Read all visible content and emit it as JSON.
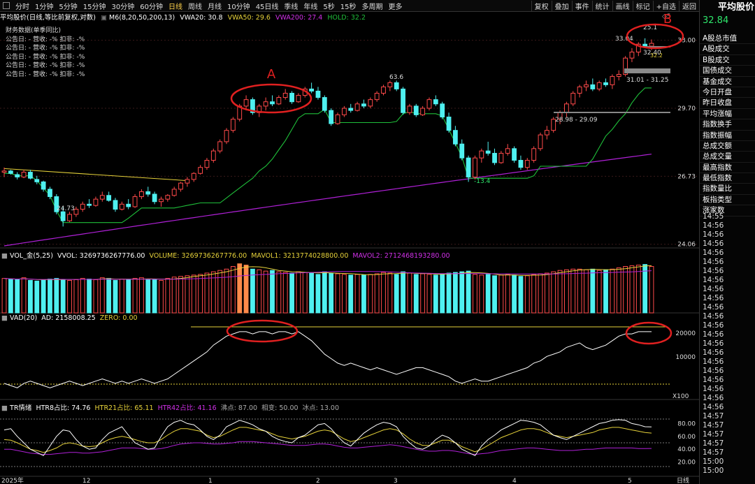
{
  "toolbar": {
    "periods": [
      "分时",
      "1分钟",
      "5分钟",
      "15分钟",
      "30分钟",
      "60分钟",
      "日线",
      "周线",
      "月线",
      "10分钟",
      "45日线",
      "季线",
      "年线",
      "5秒",
      "15秒",
      "多周期",
      "更多"
    ],
    "active_period": "日线",
    "right_buttons": [
      "复权",
      "叠加",
      "事件",
      "统计",
      "画线",
      "标记",
      "+自选",
      "返回"
    ]
  },
  "header": {
    "title": "平均股价(日线,等比前复权,对数)",
    "ma_label": "M6(8,20,50,200,13)",
    "vwa20": "VWA20: 30.8",
    "vwa50": "VWA50: 29.6",
    "vwa200": "VWA200: 27.4",
    "hold": "HOLD: 32.2"
  },
  "financials": {
    "title": "财务数据(单季同比)",
    "rows": [
      "公告日: -   营收: -%   扣非: -%",
      "公告日: -   营收: -%   扣非: -%",
      "公告日: -   营收: -%   扣非: -%",
      "公告日: -   营收: -%   扣非: -%",
      "公告日: -   营收: -%   扣非: -%"
    ]
  },
  "right_panel": {
    "title": "平均股价",
    "price": "32.84",
    "items": [
      "A股总市值",
      "A股成交",
      "B股成交",
      "国债成交",
      "基金成交",
      "今日开盘",
      "昨日收盘",
      "平均涨幅",
      "指数换手",
      "指数振幅",
      "总成交额",
      "总成交量",
      "最高指数",
      "最低指数",
      "指数量比",
      "板指类型",
      "涨家数"
    ],
    "times": [
      "14:55",
      "14:56",
      "14:56",
      "14:56",
      "14:56",
      "14:56",
      "14:56",
      "14:56",
      "14:56",
      "14:56",
      "14:56",
      "14:56",
      "14:56",
      "14:56",
      "14:56",
      "14:56",
      "14:56",
      "14:56",
      "14:56",
      "14:56",
      "14:56",
      "14:56",
      "14:57",
      "14:57",
      "14:57",
      "14:57",
      "14:57",
      "15:00",
      "15:00"
    ]
  },
  "annotations": {
    "a": "A",
    "b": "B"
  },
  "price_panel": {
    "yticks": [
      "33.00",
      "29.70",
      "26.73",
      "24.06"
    ],
    "labels": {
      "high1": "63.6",
      "low1": "24.73",
      "low2": "-13.4",
      "top_high": "25.1",
      "top_left": "33.04",
      "top_val": "32.40",
      "top_small": "32.2",
      "range1": "31.01 - 31.25",
      "range2": "28.98 - 29.09",
      "mark": "◇5"
    }
  },
  "vol_panel": {
    "name": "VOL_金(5,25)",
    "vvol": "VVOL: 3269736267776.00",
    "volume": "VOLUME: 3269736267776.00",
    "mavol1": "MAVOL1: 3213774028800.00",
    "mavol2": "MAVOL2: 2712468193280.00"
  },
  "vad_panel": {
    "name": "VAD(20)",
    "ad": "AD: 2158008.25",
    "zero": "ZERO: 0.00",
    "yticks": [
      "20000",
      "10000"
    ],
    "unit": "X100"
  },
  "tr_panel": {
    "name": "TR情绪",
    "htr8": "HTR8占比: 74.76",
    "htr21": "HTR21占比: 65.11",
    "htr42": "HTR42占比: 41.16",
    "boil": "沸点: 87.00",
    "neutral": "相变: 50.00",
    "ice": "冰点: 13.00",
    "yticks": [
      "80.00",
      "60.00",
      "40.00",
      "20.00"
    ]
  },
  "xaxis": {
    "labels": [
      "2025年",
      "12",
      "1",
      "2",
      "3",
      "4",
      "5"
    ],
    "period": "日线"
  },
  "colors": {
    "up": "#ff4a4a",
    "down": "#4ff0f0",
    "ma_green": "#1fbf3a",
    "ma_purple": "#b020d8",
    "yellow": "#e6d23a",
    "annot_red": "#e02020"
  },
  "chart_data": {
    "type": "candlestick",
    "ohlc": [
      [
        26.9,
        27.1,
        26.7,
        26.95
      ],
      [
        26.95,
        27.0,
        26.8,
        26.85
      ],
      [
        26.8,
        26.9,
        26.6,
        26.7
      ],
      [
        26.7,
        27.0,
        26.65,
        26.9
      ],
      [
        26.9,
        27.0,
        26.6,
        26.65
      ],
      [
        26.6,
        26.75,
        26.4,
        26.5
      ],
      [
        26.5,
        26.55,
        26.1,
        26.2
      ],
      [
        26.2,
        26.3,
        25.8,
        25.9
      ],
      [
        25.9,
        26.0,
        25.2,
        25.3
      ],
      [
        25.3,
        25.5,
        24.73,
        24.95
      ],
      [
        24.95,
        25.3,
        24.9,
        25.2
      ],
      [
        25.2,
        25.5,
        25.1,
        25.4
      ],
      [
        25.4,
        25.7,
        25.3,
        25.6
      ],
      [
        25.6,
        25.8,
        25.45,
        25.55
      ],
      [
        25.55,
        25.9,
        25.5,
        25.8
      ],
      [
        25.8,
        26.1,
        25.7,
        25.95
      ],
      [
        25.95,
        26.1,
        25.7,
        25.75
      ],
      [
        25.75,
        25.85,
        25.3,
        25.4
      ],
      [
        25.4,
        25.7,
        25.35,
        25.6
      ],
      [
        25.6,
        25.8,
        25.4,
        25.5
      ],
      [
        25.5,
        26.0,
        25.45,
        25.9
      ],
      [
        25.9,
        26.2,
        25.8,
        26.1
      ],
      [
        26.1,
        26.3,
        25.9,
        26.0
      ],
      [
        26.0,
        26.1,
        25.6,
        25.7
      ],
      [
        25.7,
        25.9,
        25.5,
        25.8
      ],
      [
        25.8,
        26.0,
        25.7,
        25.95
      ],
      [
        25.95,
        26.3,
        25.9,
        26.2
      ],
      [
        26.2,
        26.5,
        26.1,
        26.45
      ],
      [
        26.45,
        26.7,
        26.3,
        26.6
      ],
      [
        26.6,
        26.9,
        26.5,
        26.85
      ],
      [
        26.85,
        27.2,
        26.8,
        27.1
      ],
      [
        27.1,
        27.5,
        27.0,
        27.4
      ],
      [
        27.4,
        27.9,
        27.3,
        27.8
      ],
      [
        27.8,
        28.3,
        27.7,
        28.2
      ],
      [
        28.2,
        28.8,
        28.1,
        28.7
      ],
      [
        28.7,
        29.3,
        28.6,
        29.2
      ],
      [
        29.2,
        29.9,
        29.1,
        29.8
      ],
      [
        29.8,
        30.3,
        29.6,
        30.1
      ],
      [
        30.1,
        30.2,
        29.4,
        29.5
      ],
      [
        29.5,
        29.9,
        29.3,
        29.8
      ],
      [
        29.8,
        30.2,
        29.6,
        30.0
      ],
      [
        30.0,
        30.3,
        29.8,
        29.9
      ],
      [
        29.9,
        30.3,
        29.85,
        30.2
      ],
      [
        30.2,
        30.6,
        30.1,
        30.4
      ],
      [
        30.4,
        30.5,
        29.9,
        30.0
      ],
      [
        30.0,
        30.4,
        29.95,
        30.3
      ],
      [
        30.3,
        30.7,
        30.2,
        30.6
      ],
      [
        30.6,
        30.9,
        30.4,
        30.5
      ],
      [
        30.5,
        30.7,
        30.1,
        30.2
      ],
      [
        30.2,
        30.3,
        29.5,
        29.6
      ],
      [
        29.6,
        29.7,
        28.9,
        29.0
      ],
      [
        29.0,
        29.5,
        28.95,
        29.4
      ],
      [
        29.4,
        29.8,
        29.3,
        29.7
      ],
      [
        29.7,
        29.9,
        29.5,
        29.6
      ],
      [
        29.6,
        30.0,
        29.55,
        29.9
      ],
      [
        29.9,
        30.1,
        29.7,
        29.8
      ],
      [
        29.8,
        30.2,
        29.7,
        30.1
      ],
      [
        30.1,
        30.5,
        30.0,
        30.4
      ],
      [
        30.4,
        30.8,
        30.3,
        30.7
      ],
      [
        30.7,
        31.0,
        30.5,
        30.9
      ],
      [
        30.9,
        31.0,
        30.5,
        30.6
      ],
      [
        30.6,
        30.7,
        29.4,
        29.5
      ],
      [
        29.5,
        29.9,
        29.4,
        29.8
      ],
      [
        29.8,
        29.9,
        29.3,
        29.4
      ],
      [
        29.4,
        29.8,
        29.35,
        29.7
      ],
      [
        29.7,
        30.2,
        29.6,
        30.1
      ],
      [
        30.1,
        30.3,
        29.8,
        29.9
      ],
      [
        29.9,
        30.0,
        29.2,
        29.3
      ],
      [
        29.3,
        29.5,
        28.6,
        28.7
      ],
      [
        28.7,
        28.9,
        28.0,
        28.1
      ],
      [
        28.1,
        28.3,
        27.4,
        27.5
      ],
      [
        27.5,
        27.6,
        26.5,
        26.7
      ],
      [
        26.7,
        27.6,
        26.6,
        27.5
      ],
      [
        27.5,
        27.9,
        27.3,
        27.8
      ],
      [
        27.8,
        28.2,
        27.6,
        27.7
      ],
      [
        27.7,
        27.9,
        27.2,
        27.3
      ],
      [
        27.3,
        27.8,
        27.25,
        27.7
      ],
      [
        27.7,
        28.1,
        27.6,
        27.9
      ],
      [
        27.9,
        28.0,
        27.3,
        27.4
      ],
      [
        27.4,
        27.6,
        27.0,
        27.1
      ],
      [
        27.1,
        27.5,
        27.0,
        27.4
      ],
      [
        27.4,
        28.0,
        27.3,
        27.9
      ],
      [
        27.9,
        28.6,
        27.8,
        28.5
      ],
      [
        28.5,
        28.9,
        28.3,
        28.7
      ],
      [
        28.7,
        29.3,
        28.6,
        29.2
      ],
      [
        29.2,
        29.6,
        28.98,
        29.5
      ],
      [
        29.5,
        30.0,
        29.3,
        29.9
      ],
      [
        29.9,
        30.5,
        29.8,
        30.4
      ],
      [
        30.4,
        30.8,
        30.2,
        30.7
      ],
      [
        30.7,
        31.0,
        30.5,
        30.8
      ],
      [
        30.8,
        31.1,
        30.5,
        30.6
      ],
      [
        30.6,
        31.0,
        30.5,
        30.9
      ],
      [
        30.9,
        31.1,
        30.7,
        30.8
      ],
      [
        30.8,
        31.3,
        30.6,
        31.2
      ],
      [
        31.2,
        31.5,
        31.01,
        31.3
      ],
      [
        31.3,
        32.2,
        31.2,
        32.1
      ],
      [
        32.1,
        32.6,
        31.9,
        32.4
      ],
      [
        32.4,
        32.9,
        32.2,
        32.8
      ],
      [
        32.8,
        33.1,
        32.6,
        32.7
      ],
      [
        32.7,
        33.04,
        32.5,
        32.84
      ]
    ],
    "volume": [
      52,
      51,
      50,
      53,
      49,
      48,
      50,
      51,
      52,
      50,
      49,
      50,
      52,
      51,
      50,
      53,
      52,
      49,
      51,
      50,
      52,
      53,
      51,
      50,
      49,
      52,
      54,
      55,
      56,
      57,
      58,
      60,
      62,
      64,
      66,
      70,
      74,
      72,
      66,
      65,
      63,
      64,
      62,
      61,
      60,
      62,
      61,
      60,
      58,
      62,
      60,
      59,
      58,
      57,
      58,
      57,
      58,
      59,
      61,
      60,
      58,
      62,
      60,
      58,
      59,
      58,
      57,
      59,
      60,
      61,
      62,
      63,
      58,
      57,
      58,
      56,
      57,
      58,
      57,
      55,
      56,
      58,
      59,
      60,
      62,
      64,
      65,
      66,
      66,
      65,
      66,
      64,
      65,
      66,
      68,
      70,
      71,
      72,
      73,
      70
    ],
    "ylim": [
      24.0,
      34.0
    ],
    "vad": [
      5,
      4,
      3,
      5,
      6,
      5,
      4,
      3,
      4,
      5,
      6,
      5,
      4,
      5,
      6,
      7,
      6,
      5,
      6,
      5,
      6,
      7,
      6,
      5,
      6,
      7,
      9,
      11,
      13,
      15,
      17,
      19,
      22,
      24,
      26,
      27,
      28,
      28,
      27,
      28,
      28,
      27,
      28,
      28,
      27,
      28,
      26,
      24,
      21,
      18,
      16,
      14,
      13,
      14,
      13,
      12,
      11,
      12,
      11,
      10,
      9,
      10,
      11,
      12,
      12,
      11,
      10,
      9,
      8,
      6,
      5,
      6,
      7,
      6,
      6,
      7,
      8,
      9,
      10,
      11,
      12,
      14,
      15,
      17,
      18,
      19,
      21,
      22,
      23,
      21,
      20,
      21,
      22,
      24,
      26,
      27,
      27,
      28,
      28,
      28
    ],
    "htr8": [
      70,
      72,
      60,
      50,
      40,
      35,
      30,
      45,
      60,
      70,
      68,
      55,
      45,
      40,
      42,
      55,
      65,
      70,
      75,
      62,
      50,
      45,
      40,
      42,
      60,
      75,
      82,
      85,
      80,
      78,
      70,
      60,
      55,
      62,
      75,
      80,
      85,
      82,
      78,
      72,
      68,
      60,
      55,
      52,
      50,
      58,
      62,
      70,
      78,
      80,
      72,
      60,
      50,
      45,
      55,
      65,
      72,
      78,
      82,
      80,
      75,
      60,
      50,
      42,
      40,
      45,
      55,
      62,
      58,
      50,
      40,
      35,
      30,
      45,
      55,
      62,
      70,
      75,
      80,
      85,
      84,
      82,
      78,
      70,
      62,
      58,
      55,
      60,
      65,
      70,
      75,
      80,
      82,
      85,
      86,
      85,
      80,
      78,
      75,
      74.76
    ],
    "htr21": [
      55,
      54,
      50,
      45,
      40,
      38,
      35,
      38,
      42,
      48,
      50,
      48,
      45,
      44,
      45,
      50,
      55,
      58,
      60,
      58,
      55,
      52,
      50,
      50,
      55,
      62,
      68,
      72,
      72,
      70,
      68,
      62,
      58,
      60,
      65,
      70,
      74,
      74,
      72,
      70,
      68,
      64,
      60,
      58,
      56,
      58,
      60,
      64,
      68,
      70,
      68,
      62,
      56,
      52,
      54,
      58,
      62,
      66,
      70,
      72,
      70,
      64,
      56,
      50,
      46,
      46,
      50,
      54,
      54,
      50,
      44,
      40,
      36,
      40,
      46,
      52,
      58,
      62,
      66,
      70,
      72,
      72,
      70,
      66,
      62,
      60,
      58,
      60,
      62,
      64,
      66,
      70,
      72,
      74,
      74,
      72,
      70,
      68,
      66,
      65.11
    ],
    "htr42": [
      40,
      40,
      38,
      36,
      34,
      33,
      32,
      32,
      33,
      34,
      35,
      35,
      34,
      34,
      35,
      36,
      38,
      40,
      42,
      42,
      42,
      41,
      40,
      40,
      41,
      43,
      46,
      48,
      49,
      50,
      50,
      49,
      48,
      48,
      49,
      50,
      52,
      52,
      52,
      51,
      50,
      49,
      48,
      47,
      46,
      46,
      46,
      47,
      48,
      48,
      47,
      45,
      43,
      42,
      42,
      43,
      44,
      45,
      46,
      47,
      46,
      44,
      42,
      40,
      38,
      37,
      37,
      38,
      38,
      37,
      35,
      33,
      32,
      33,
      34,
      36,
      38,
      39,
      40,
      41,
      42,
      42,
      41,
      40,
      39,
      38,
      38,
      38,
      39,
      40,
      40,
      41,
      42,
      42,
      42,
      42,
      42,
      41,
      41,
      41.16
    ]
  }
}
